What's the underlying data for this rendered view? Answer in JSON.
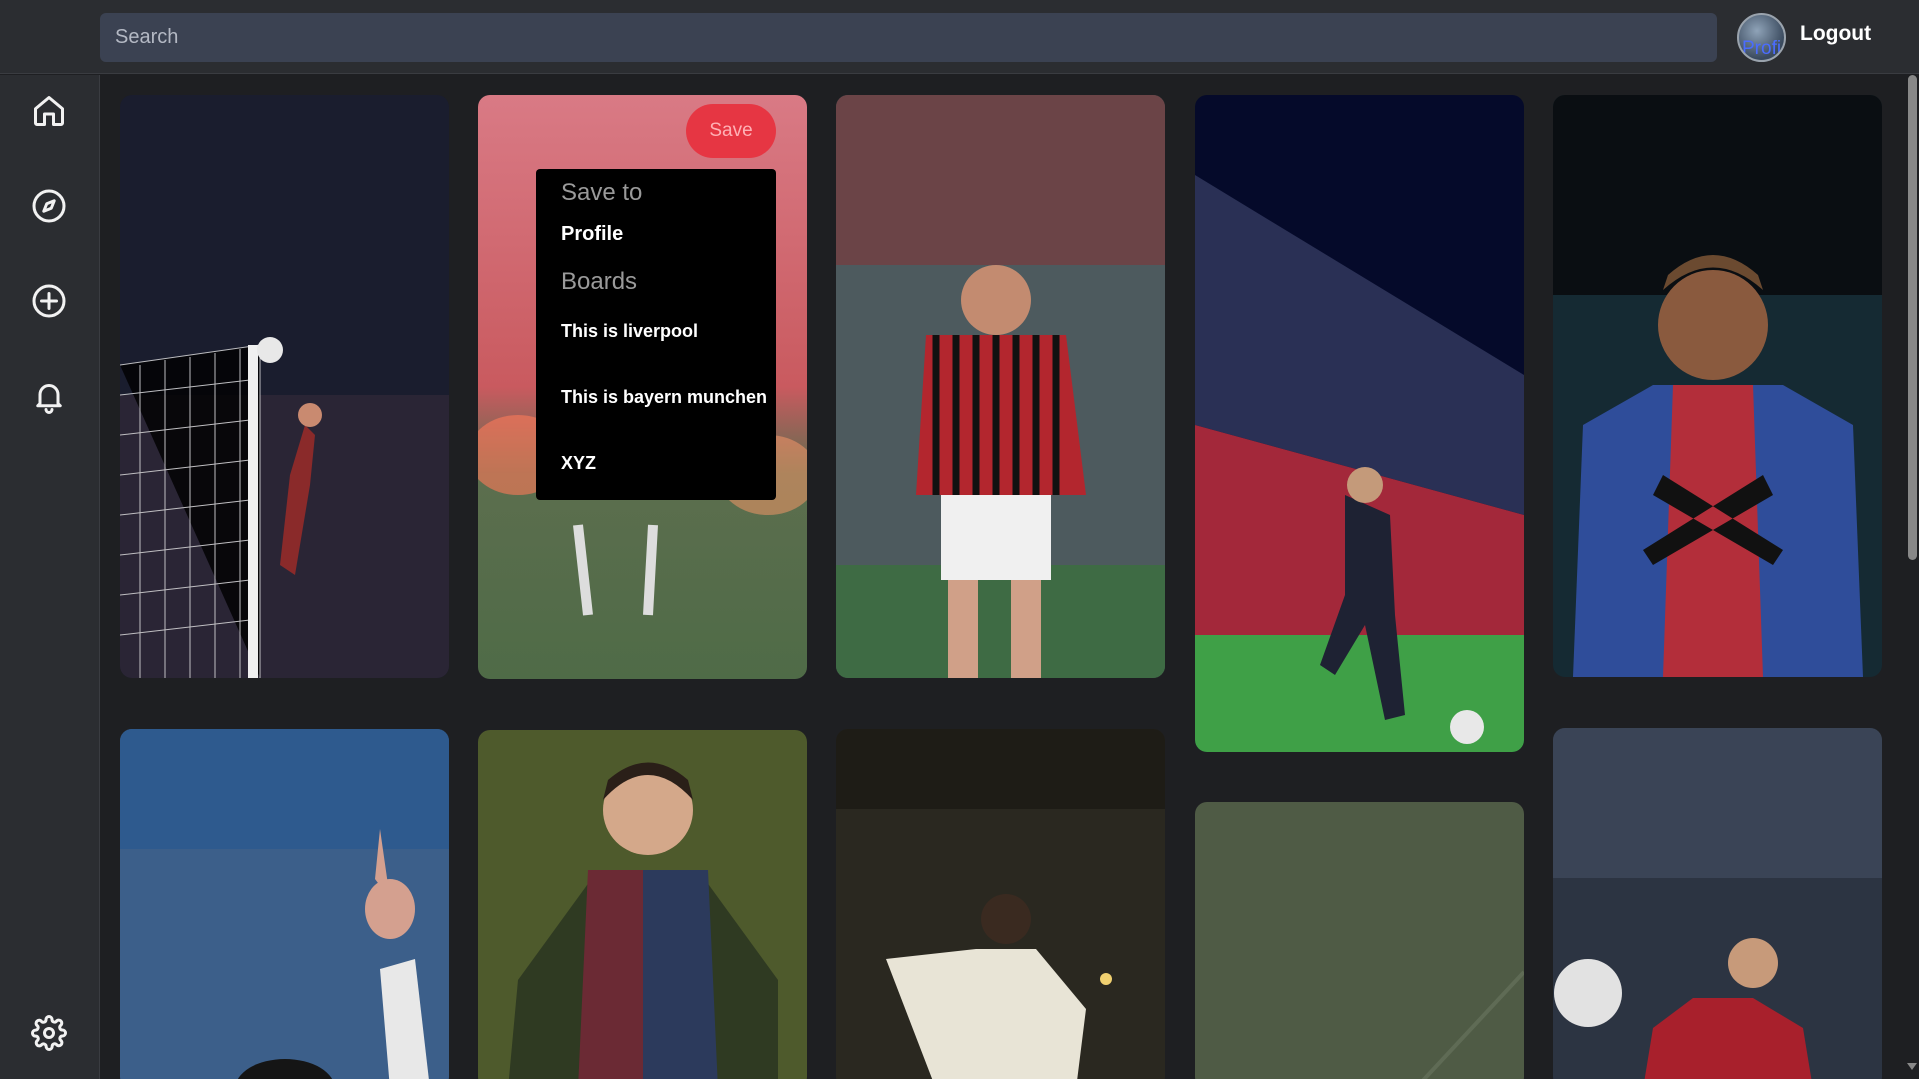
{
  "search": {
    "placeholder": "Search"
  },
  "avatar": {
    "alt_text": "Profi"
  },
  "header": {
    "logout_label": "Logout"
  },
  "sidebar": {
    "icons": [
      "home-icon",
      "compass-icon",
      "plus-circle-icon",
      "bell-icon",
      "gear-icon"
    ]
  },
  "save_button": {
    "label": "Save"
  },
  "save_menu": {
    "heading": "Save to",
    "profile_label": "Profile",
    "boards_heading": "Boards",
    "boards": [
      "This is liverpool",
      "This is bayern munchen",
      "XYZ"
    ]
  },
  "colors": {
    "accent": "#e63643",
    "background": "#1e1f22",
    "panel": "#2b2d31",
    "search_bg": "#3b4252"
  }
}
